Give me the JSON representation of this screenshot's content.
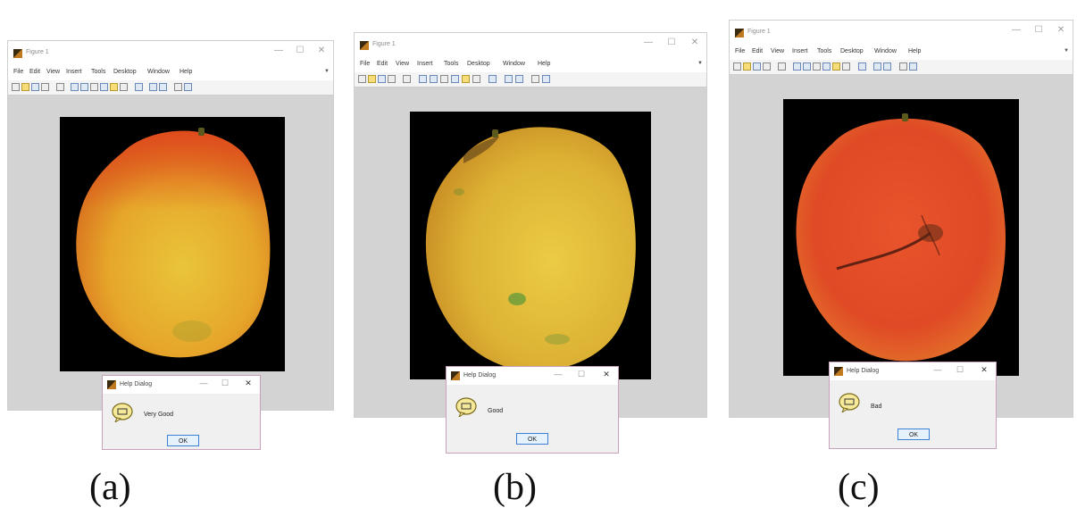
{
  "figures": [
    {
      "window_title": "Figure 1",
      "menu": [
        "File",
        "Edit",
        "View",
        "Insert",
        "Tools",
        "Desktop",
        "Window",
        "Help"
      ],
      "dialog": {
        "title": "Help Dialog",
        "message": "Very Good",
        "ok_label": "OK"
      },
      "panel_label": "(a)"
    },
    {
      "window_title": "Figure 1",
      "menu": [
        "File",
        "Edit",
        "View",
        "Insert",
        "Tools",
        "Desktop",
        "Window",
        "Help"
      ],
      "dialog": {
        "title": "Help Dialog",
        "message": "Good",
        "ok_label": "OK"
      },
      "panel_label": "(b)"
    },
    {
      "window_title": "Figure 1",
      "menu": [
        "File",
        "Edit",
        "View",
        "Insert",
        "Tools",
        "Desktop",
        "Window",
        "Help"
      ],
      "dialog": {
        "title": "Help Dialog",
        "message": "Bad",
        "ok_label": "OK"
      },
      "panel_label": "(c)"
    }
  ],
  "window_controls": {
    "minimize": "—",
    "maximize": "☐",
    "close": "✕"
  },
  "icons": [
    "new-file-icon",
    "open-icon",
    "save-icon",
    "print-icon",
    "pointer-icon",
    "zoom-in-icon",
    "zoom-out-icon",
    "pan-icon",
    "rotate-icon",
    "data-cursor-icon",
    "brush-icon",
    "link-icon",
    "colorbar-icon",
    "legend-icon",
    "grid-icon",
    "property-editor-icon"
  ],
  "colors": {
    "figure_background": "#d3d3d3",
    "axes_background": "#000000",
    "mango_a": "#e8a828",
    "mango_b": "#d8b23a",
    "mango_c": "#e0502a"
  }
}
